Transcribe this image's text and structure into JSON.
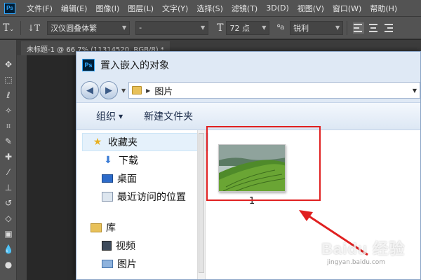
{
  "app": {
    "logo_text": "Ps",
    "menu": [
      "文件(F)",
      "编辑(E)",
      "图像(I)",
      "图层(L)",
      "文字(Y)",
      "选择(S)",
      "滤镜(T)",
      "3D(D)",
      "视图(V)",
      "窗口(W)",
      "帮助(H)"
    ]
  },
  "options_bar": {
    "font_family": "汉仪圆叠体繁",
    "font_style": "-",
    "font_size": "72 点",
    "aa_label": "ªa",
    "anti_alias": "锐利"
  },
  "document_tab": {
    "label": "未标题-1 @ 66.7% (11314520, RGB/8) *"
  },
  "dialog": {
    "title": "置入嵌入的对象",
    "icon_text": "Ps",
    "address": "图片",
    "toolbar": {
      "organize": "组织",
      "new_folder": "新建文件夹"
    },
    "nav_items": [
      {
        "label": "收藏夹",
        "icon": "star-icon",
        "level": "top"
      },
      {
        "label": "下载",
        "icon": "download-folder-icon",
        "level": "sub"
      },
      {
        "label": "桌面",
        "icon": "desktop-icon",
        "level": "sub"
      },
      {
        "label": "最近访问的位置",
        "icon": "recent-places-icon",
        "level": "sub"
      },
      {
        "label": "库",
        "icon": "library-icon",
        "level": "top"
      },
      {
        "label": "视频",
        "icon": "video-icon",
        "level": "sub"
      },
      {
        "label": "图片",
        "icon": "pictures-icon",
        "level": "sub"
      }
    ],
    "files": [
      {
        "name": "1",
        "thumbnail": "green-tea-hill-image"
      }
    ]
  },
  "annotation": {
    "highlight_color": "#e02020"
  },
  "watermark": {
    "main": "Baidu 经验",
    "sub": "jingyan.baidu.com"
  }
}
